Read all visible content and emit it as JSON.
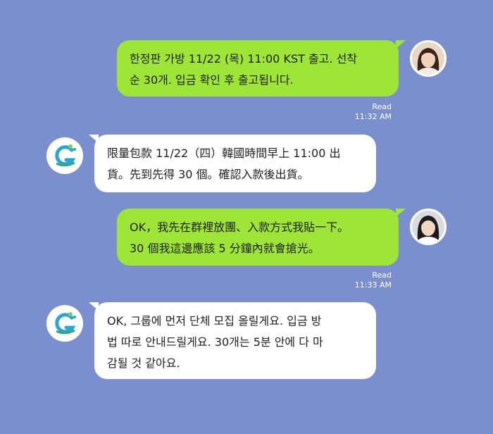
{
  "messages": [
    {
      "direction": "outgoing",
      "text": "한정판 가방 11/22 (목) 11:00 KST 출고. 선착\n순 30개. 입금 확인 후 출고됩니다.",
      "status": "Read",
      "time": "11:32 AM",
      "avatar": "user-photo-avatar"
    },
    {
      "direction": "incoming",
      "text": "限量包款 11/22（四）韓國時間早上 11:00 出\n貨。先到先得 30 個。確認入款後出貨。",
      "avatar": "bot-logo-avatar"
    },
    {
      "direction": "outgoing",
      "text": "OK，我先在群裡放團、入款方式我貼一下。\n30 個我這邊應該 5 分鐘內就會搶光。",
      "status": "Read",
      "time": "11:33 AM",
      "avatar": "user-photo-avatar"
    },
    {
      "direction": "incoming",
      "text": "OK, 그룹에 먼저 단체 모집 올릴게요. 입금 방\n법 따로 안내드릴게요. 30개는 5분 안에 다 마\n감될 것 같아요.",
      "avatar": "bot-logo-avatar"
    }
  ],
  "colors": {
    "background": "#7b8fcf",
    "outgoing_bubble": "#9ee537",
    "incoming_bubble": "#ffffff"
  }
}
